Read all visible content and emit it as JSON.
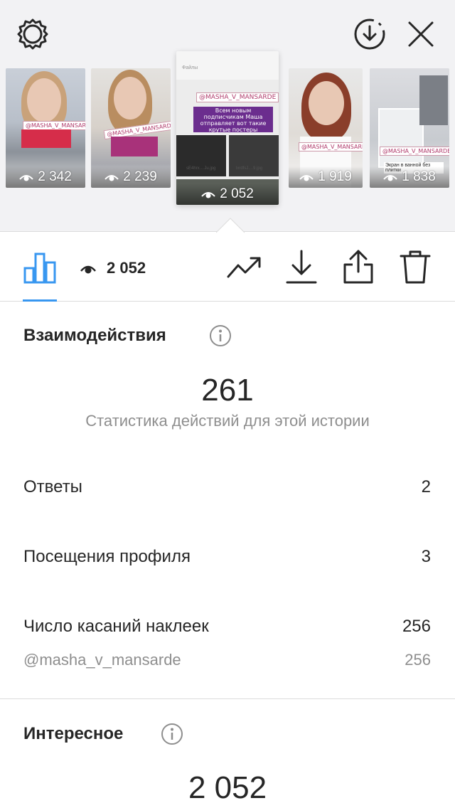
{
  "gallery": {
    "thumbs": [
      {
        "views": "2 342",
        "tag": "@MASHA_V_MANSARDE"
      },
      {
        "views": "2 239",
        "tag": "@MASHA_V_MANSARDE"
      },
      {
        "views": "2 052",
        "tag": "@MASHA_V_MANSARDE",
        "caption": "Всем новым подписчикам Маша отправляет вот такие крутые постеры",
        "header": "Файлы",
        "file1": "sE4hrx....Ju.jpg",
        "file2": "lxrdfsJ....9.jpg"
      },
      {
        "views": "1 919",
        "tag": "@MASHA_V_MANSARDE"
      },
      {
        "views": "1 838",
        "tag": "@MASHA_V_MANSARDE",
        "caption": "Экран в ванной без плитки"
      }
    ]
  },
  "toolbar": {
    "views_count": "2 052"
  },
  "interactions": {
    "title": "Взаимодействия",
    "total": "261",
    "caption": "Статистика действий для этой истории",
    "rows": [
      {
        "label": "Ответы",
        "value": "2"
      },
      {
        "label": "Посещения профиля",
        "value": "3"
      },
      {
        "label": "Число касаний наклеек",
        "value": "256"
      }
    ],
    "sticker": {
      "label": "@masha_v_mansarde",
      "value": "256"
    }
  },
  "discovery": {
    "title": "Интересное",
    "total": "2 052"
  },
  "colors": {
    "accent": "#3897f0",
    "text": "#262626",
    "secondary": "#8e8e8e"
  },
  "icons": [
    "settings-gear-icon",
    "download-circle-icon",
    "close-icon",
    "bar-chart-icon",
    "eye-icon",
    "trending-icon",
    "download-icon",
    "share-icon",
    "trash-icon",
    "info-icon"
  ]
}
